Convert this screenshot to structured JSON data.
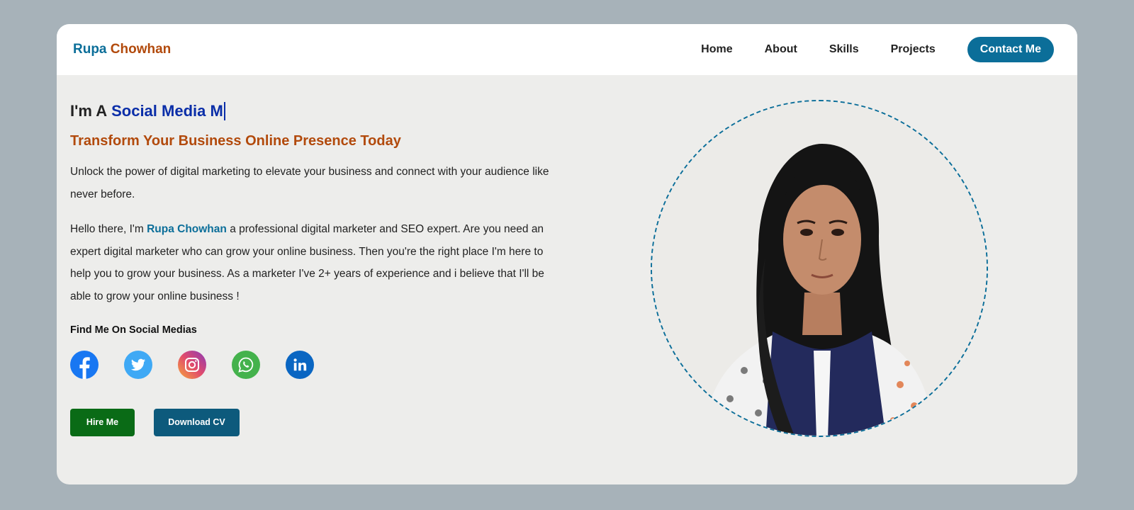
{
  "brand": {
    "first": "Rupa",
    "last": "Chowhan"
  },
  "nav": {
    "items": [
      {
        "label": "Home"
      },
      {
        "label": "About"
      },
      {
        "label": "Skills"
      },
      {
        "label": "Projects"
      }
    ],
    "contact_label": "Contact Me"
  },
  "hero": {
    "prefix": "I'm A",
    "typed": "Social Media M",
    "tagline": "Transform Your Business Online Presence Today",
    "intro": "Unlock the power of digital marketing to elevate your business and connect with your audience like never before.",
    "about_pre": "Hello there, I'm",
    "about_name": "Rupa Chowhan",
    "about_post": "a professional digital marketer and SEO expert. Are you need an expert digital marketer who can grow your online business. Then you're the right place I'm here to help you to grow your business. As a marketer I've 2+ years of experience and i believe that I'll be able to grow your online business !",
    "social_title": "Find Me On Social Medias",
    "hire_label": "Hire Me",
    "cv_label": "Download CV"
  },
  "socials": [
    {
      "icon": "facebook-icon",
      "color": "#1877f2"
    },
    {
      "icon": "twitter-icon",
      "color": "#3fa9f5"
    },
    {
      "icon": "instagram-icon",
      "color": "#e14b6c"
    },
    {
      "icon": "whatsapp-icon",
      "color": "#44b24c"
    },
    {
      "icon": "linkedin-icon",
      "color": "#0a66c2"
    }
  ],
  "colors": {
    "accent": "#0b6e99",
    "brand_orange": "#b24a0c",
    "typed_blue": "#0a2ea8",
    "hire_green": "#0a6b16",
    "cv_blue": "#0d5a7c"
  }
}
